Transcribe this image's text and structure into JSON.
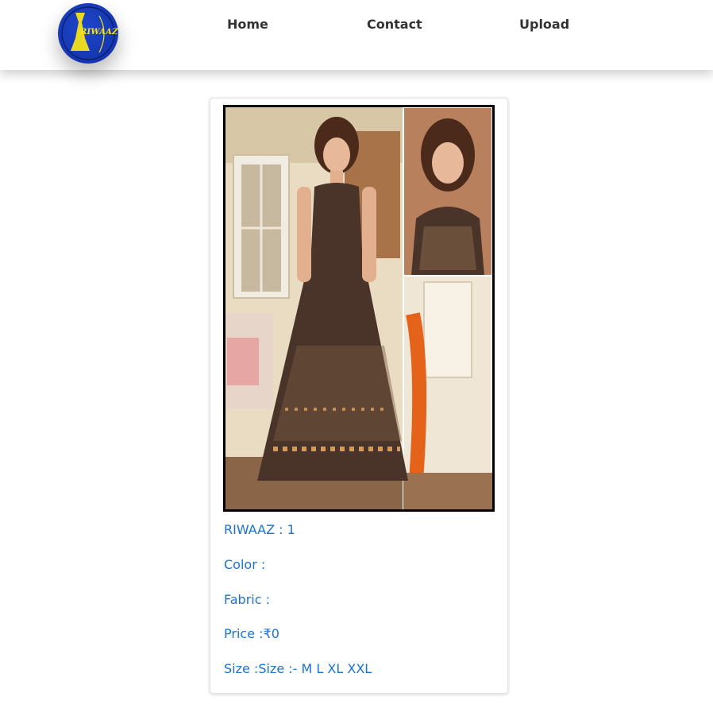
{
  "brand": {
    "logo_text": "RIWAAZ",
    "logo_color": "#1535b0",
    "logo_text_color": "#f5e21a"
  },
  "nav": [
    {
      "label": "Home"
    },
    {
      "label": "Contact"
    },
    {
      "label": "Upload"
    }
  ],
  "product": {
    "title": "RIWAAZ : 1",
    "color": "Color :",
    "fabric": "Fabric :",
    "price": "Price :₹0",
    "size": "Size :Size :- M L XL XXL",
    "text_color": "#1a73d6"
  }
}
